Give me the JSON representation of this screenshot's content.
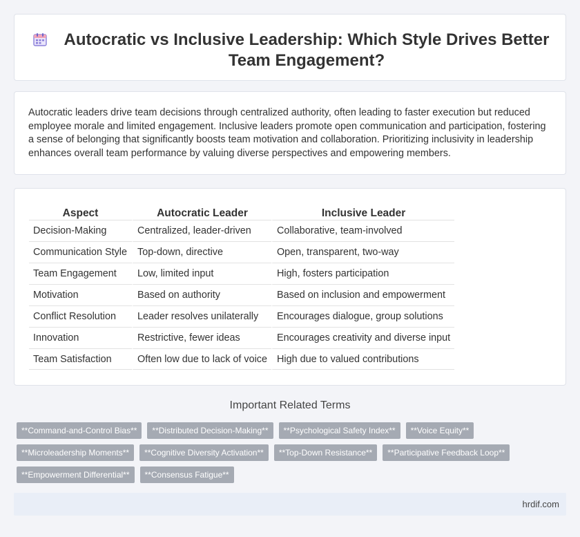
{
  "header": {
    "icon": "calendar-icon",
    "title": "Autocratic vs Inclusive Leadership: Which Style Drives Better Team Engagement?"
  },
  "summary": "Autocratic leaders drive team decisions through centralized authority, often leading to faster execution but reduced employee morale and limited engagement. Inclusive leaders promote open communication and participation, fostering a sense of belonging that significantly boosts team motivation and collaboration. Prioritizing inclusivity in leadership enhances overall team performance by valuing diverse perspectives and empowering members.",
  "table": {
    "headers": [
      "Aspect",
      "Autocratic Leader",
      "Inclusive Leader"
    ],
    "rows": [
      [
        "Decision-Making",
        "Centralized, leader-driven",
        "Collaborative, team-involved"
      ],
      [
        "Communication Style",
        "Top-down, directive",
        "Open, transparent, two-way"
      ],
      [
        "Team Engagement",
        "Low, limited input",
        "High, fosters participation"
      ],
      [
        "Motivation",
        "Based on authority",
        "Based on inclusion and empowerment"
      ],
      [
        "Conflict Resolution",
        "Leader resolves unilaterally",
        "Encourages dialogue, group solutions"
      ],
      [
        "Innovation",
        "Restrictive, fewer ideas",
        "Encourages creativity and diverse input"
      ],
      [
        "Team Satisfaction",
        "Often low due to lack of voice",
        "High due to valued contributions"
      ]
    ]
  },
  "related": {
    "title": "Important Related Terms",
    "tags": [
      "**Command-and-Control Bias**",
      "**Distributed Decision-Making**",
      "**Psychological Safety Index**",
      "**Voice Equity**",
      "**Microleadership Moments**",
      "**Cognitive Diversity Activation**",
      "**Top-Down Resistance**",
      "**Participative Feedback Loop**",
      "**Empowerment Differential**",
      "**Consensus Fatigue**"
    ]
  },
  "footer": {
    "site": "hrdif.com"
  }
}
